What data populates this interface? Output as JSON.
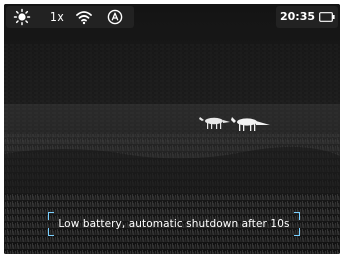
{
  "status_bar": {
    "brightness_icon": "sun-icon",
    "zoom_label": "1x",
    "wifi_icon": "wifi-icon",
    "auto_mode_icon": "auto-calibration-icon",
    "clock": "20:35",
    "battery_icon": "battery-empty-icon"
  },
  "notice": {
    "text": "Low battery, automatic shutdown after 10s"
  },
  "scene": {
    "subject_icon": "foxes-thermal-silhouette"
  },
  "colors": {
    "device_background": "#0b0b0b",
    "status_bar_background": "#222222",
    "text": "#ffffff",
    "notice_bracket": "#7ad0ff"
  }
}
